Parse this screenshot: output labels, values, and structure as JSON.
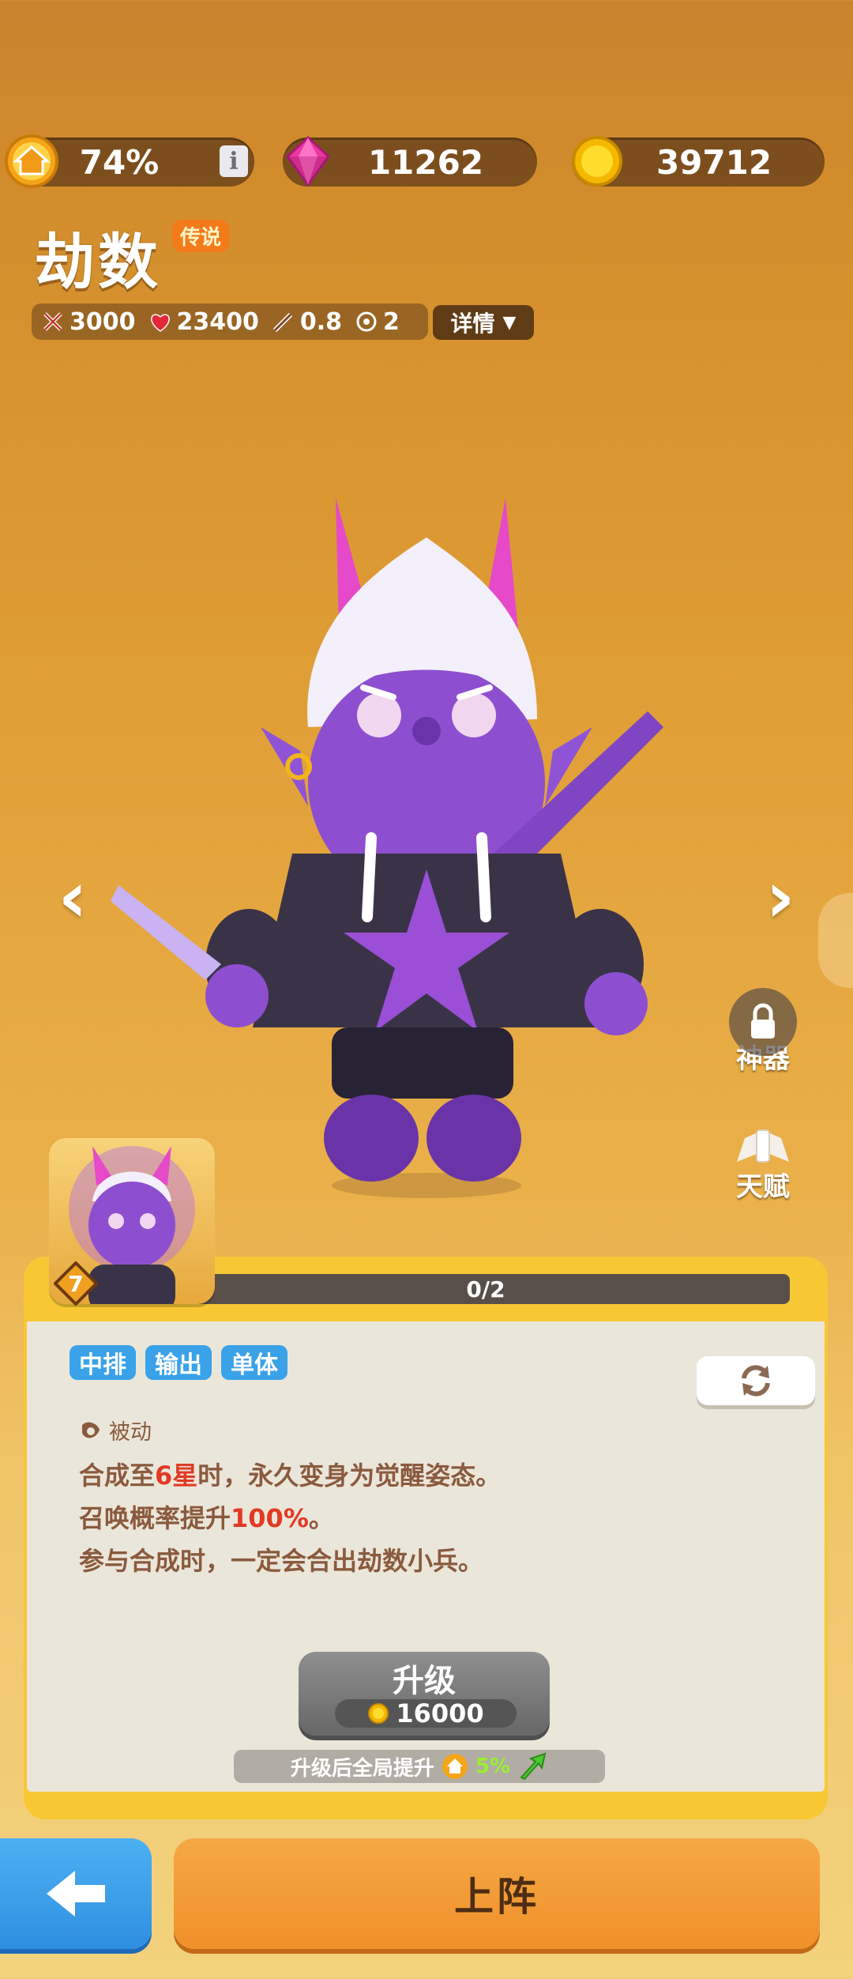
{
  "resources": {
    "power_percent": "74%",
    "info_label": "i",
    "gems": "11262",
    "coins": "39712"
  },
  "hero": {
    "name": "劫数",
    "rarity": "传说"
  },
  "stats": {
    "attack": "3000",
    "hp": "23400",
    "speed": "0.8",
    "range": "2",
    "details_label": "详情"
  },
  "side_buttons": {
    "artifact": "神器",
    "talent": "天赋"
  },
  "card": {
    "level": "7",
    "progress_text": "0/2",
    "progress_fraction": 0
  },
  "tags": [
    "中排",
    "输出",
    "单体"
  ],
  "skill": {
    "type_label": "被动",
    "line1_a": "合成至",
    "line1_b": "6星",
    "line1_c": "时，永久变身为觉醒姿态。",
    "line2_a": "召唤概率提升",
    "line2_b": "100%",
    "line2_c": "。",
    "line3": "参与合成时，一定会合出劫数小兵。"
  },
  "upgrade": {
    "title": "升级",
    "cost": "16000",
    "after_label": "升级后全局提升",
    "after_value": "5%"
  },
  "bottom": {
    "deploy_label": "上阵"
  },
  "colors": {
    "tag_blue": "#39a2e8",
    "panel_yellow": "#f7c834",
    "deploy_orange": "#f0902a",
    "back_blue": "#2f8fe0"
  }
}
